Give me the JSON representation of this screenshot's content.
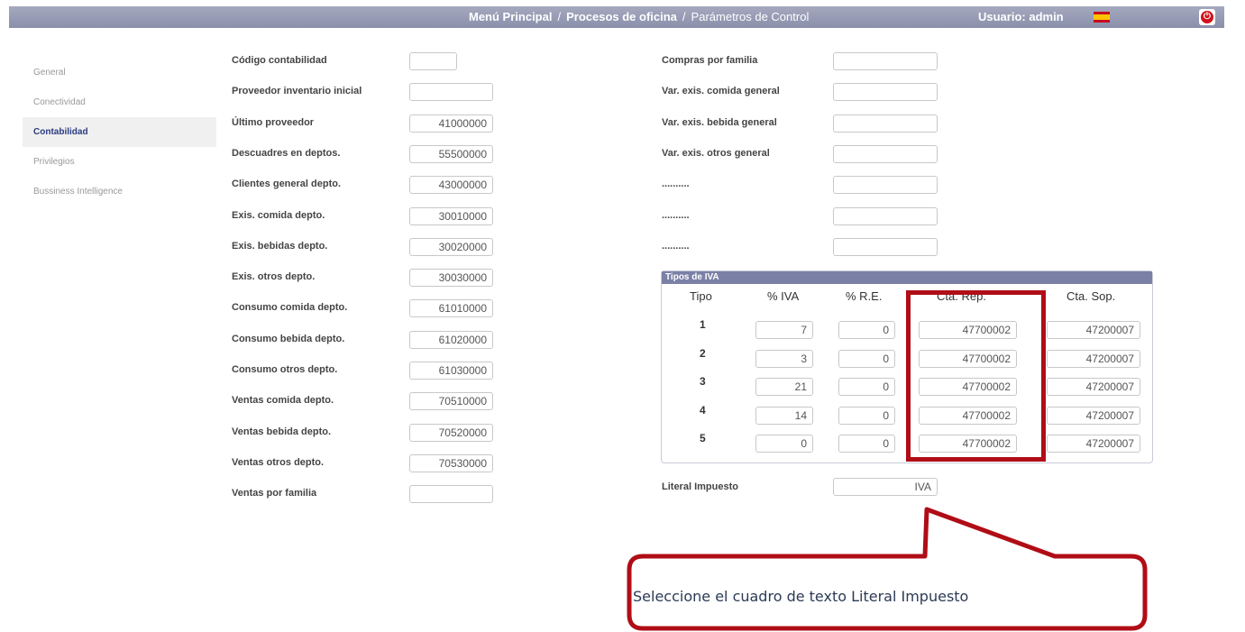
{
  "header": {
    "breadcrumb": [
      "Menú Principal",
      "Procesos de oficina",
      "Parámetros de Control"
    ],
    "separator": "/",
    "user": "Usuario: admin",
    "flag_icon": "spain-flag-icon",
    "power_icon": "power-icon"
  },
  "sidebar": {
    "items": [
      {
        "label": "General",
        "active": false
      },
      {
        "label": "Conectividad",
        "active": false
      },
      {
        "label": "Contabilidad",
        "active": true
      },
      {
        "label": "Privilegios",
        "active": false
      },
      {
        "label": "Bussiness Intelligence",
        "active": false
      }
    ]
  },
  "left_fields": [
    {
      "label": "Código contabilidad",
      "value": ""
    },
    {
      "label": "Proveedor inventario inicial",
      "value": ""
    },
    {
      "label": "Último proveedor",
      "value": "41000000"
    },
    {
      "label": "Descuadres en deptos.",
      "value": "55500000"
    },
    {
      "label": "Clientes general depto.",
      "value": "43000000"
    },
    {
      "label": "Exis. comida depto.",
      "value": "30010000"
    },
    {
      "label": "Exis. bebidas depto.",
      "value": "30020000"
    },
    {
      "label": "Exis. otros depto.",
      "value": "30030000"
    },
    {
      "label": "Consumo comida depto.",
      "value": "61010000"
    },
    {
      "label": "Consumo bebida depto.",
      "value": "61020000"
    },
    {
      "label": "Consumo otros depto.",
      "value": "61030000"
    },
    {
      "label": "Ventas comida depto.",
      "value": "70510000"
    },
    {
      "label": "Ventas bebida depto.",
      "value": "70520000"
    },
    {
      "label": "Ventas otros depto.",
      "value": "70530000"
    },
    {
      "label": "Ventas por familia",
      "value": ""
    }
  ],
  "right_fields": [
    {
      "label": "Compras por familia",
      "value": ""
    },
    {
      "label": "Var. exis. comida general",
      "value": ""
    },
    {
      "label": "Var. exis. bebida general",
      "value": ""
    },
    {
      "label": "Var. exis. otros general",
      "value": ""
    },
    {
      "label": "..........",
      "value": ""
    },
    {
      "label": "..........",
      "value": ""
    },
    {
      "label": "..........",
      "value": ""
    }
  ],
  "iva": {
    "title": "Tipos de IVA",
    "columns": [
      "Tipo",
      "% IVA",
      "% R.E.",
      "Cta. Rep.",
      "Cta. Sop."
    ],
    "rows": [
      {
        "tipo": "1",
        "iva": "7",
        "re": "0",
        "rep": "47700002",
        "sop": "47200007"
      },
      {
        "tipo": "2",
        "iva": "3",
        "re": "0",
        "rep": "47700002",
        "sop": "47200007"
      },
      {
        "tipo": "3",
        "iva": "21",
        "re": "0",
        "rep": "47700002",
        "sop": "47200007"
      },
      {
        "tipo": "4",
        "iva": "14",
        "re": "0",
        "rep": "47700002",
        "sop": "47200007"
      },
      {
        "tipo": "5",
        "iva": "0",
        "re": "0",
        "rep": "47700002",
        "sop": "47200007"
      }
    ]
  },
  "literal": {
    "label": "Literal Impuesto",
    "value": "IVA"
  },
  "callout": {
    "text": "Seleccione el cuadro de texto Literal Impuesto",
    "color": "#b00d17"
  },
  "colors": {
    "accent": "#2b3a80",
    "header": "#8a8fab",
    "highlight": "#b00d17"
  }
}
